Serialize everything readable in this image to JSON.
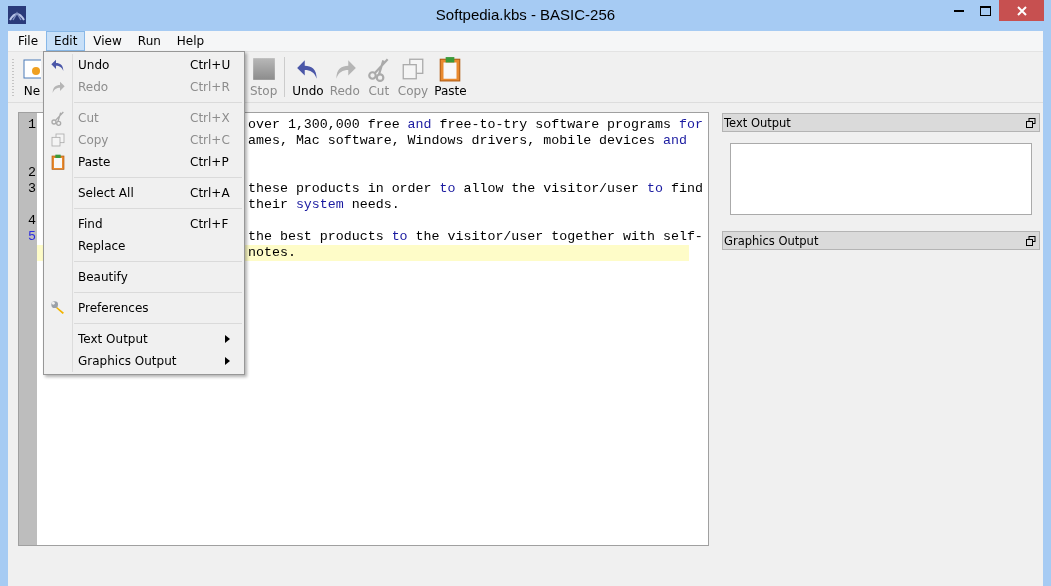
{
  "window": {
    "title": "Softpedia.kbs - BASIC-256"
  },
  "menubar": [
    {
      "label": "File",
      "selected": false
    },
    {
      "label": "Edit",
      "selected": true
    },
    {
      "label": "View",
      "selected": false
    },
    {
      "label": "Run",
      "selected": false
    },
    {
      "label": "Help",
      "selected": false
    }
  ],
  "toolbar": [
    {
      "kind": "button",
      "label": "Ne",
      "disabled": false
    },
    {
      "kind": "button",
      "label": "Stop",
      "disabled": true
    },
    {
      "kind": "separator"
    },
    {
      "kind": "button",
      "label": "Undo",
      "disabled": false
    },
    {
      "kind": "button",
      "label": "Redo",
      "disabled": true
    },
    {
      "kind": "button",
      "label": "Cut",
      "disabled": true
    },
    {
      "kind": "button",
      "label": "Copy",
      "disabled": true
    },
    {
      "kind": "button",
      "label": "Paste",
      "disabled": false
    }
  ],
  "edit_menu": [
    {
      "kind": "item",
      "label": "Undo",
      "shortcut": "Ctrl+U",
      "disabled": false
    },
    {
      "kind": "item",
      "label": "Redo",
      "shortcut": "Ctrl+R",
      "disabled": true
    },
    {
      "kind": "separator"
    },
    {
      "kind": "item",
      "label": "Cut",
      "shortcut": "Ctrl+X",
      "disabled": true
    },
    {
      "kind": "item",
      "label": "Copy",
      "shortcut": "Ctrl+C",
      "disabled": true
    },
    {
      "kind": "item",
      "label": "Paste",
      "shortcut": "Ctrl+P",
      "disabled": false
    },
    {
      "kind": "separator"
    },
    {
      "kind": "item",
      "label": "Select All",
      "shortcut": "Ctrl+A",
      "disabled": false
    },
    {
      "kind": "separator"
    },
    {
      "kind": "item",
      "label": "Find",
      "shortcut": "Ctrl+F",
      "disabled": false
    },
    {
      "kind": "item",
      "label": "Replace",
      "disabled": false
    },
    {
      "kind": "separator"
    },
    {
      "kind": "item",
      "label": "Beautify",
      "disabled": false
    },
    {
      "kind": "separator"
    },
    {
      "kind": "item",
      "label": "Preferences",
      "disabled": false
    },
    {
      "kind": "separator"
    },
    {
      "kind": "submenu",
      "label": "Text Output",
      "disabled": false
    },
    {
      "kind": "submenu",
      "label": "Graphics Output",
      "disabled": false
    }
  ],
  "editor": {
    "rows": [
      {
        "number": "1",
        "current": false,
        "segments": [
          {
            "text": "over 1,300,000 free ",
            "keyword": false
          },
          {
            "text": "and",
            "keyword": true
          },
          {
            "text": " free-to-try software programs ",
            "keyword": false
          },
          {
            "text": "for",
            "keyword": true
          }
        ]
      },
      {
        "segments": [
          {
            "text": "ames, Mac software, Windows drivers, mobile devices ",
            "keyword": false
          },
          {
            "text": "and",
            "keyword": true
          }
        ]
      },
      {
        "segments": []
      },
      {
        "number": "2",
        "current": false,
        "segments": []
      },
      {
        "number": "3",
        "current": false,
        "segments": [
          {
            "text": "these products in order ",
            "keyword": false
          },
          {
            "text": "to",
            "keyword": true
          },
          {
            "text": " allow the visitor/user ",
            "keyword": false
          },
          {
            "text": "to",
            "keyword": true
          },
          {
            "text": " find",
            "keyword": false
          }
        ]
      },
      {
        "segments": [
          {
            "text": "their ",
            "keyword": false
          },
          {
            "text": "system",
            "keyword": true
          },
          {
            "text": " needs.",
            "keyword": false
          }
        ]
      },
      {
        "number": "4",
        "current": false,
        "segments": []
      },
      {
        "number": "5",
        "current": true,
        "segments": [
          {
            "text": "the best products ",
            "keyword": false
          },
          {
            "text": "to",
            "keyword": true
          },
          {
            "text": " the visitor/user together with self-",
            "keyword": false
          }
        ]
      },
      {
        "highlighted": true,
        "segments": [
          {
            "text": "notes.",
            "keyword": false
          }
        ]
      }
    ]
  },
  "docks": [
    {
      "title": "Text Output",
      "kind": "text"
    },
    {
      "title": "Graphics Output",
      "kind": "graphics"
    }
  ]
}
